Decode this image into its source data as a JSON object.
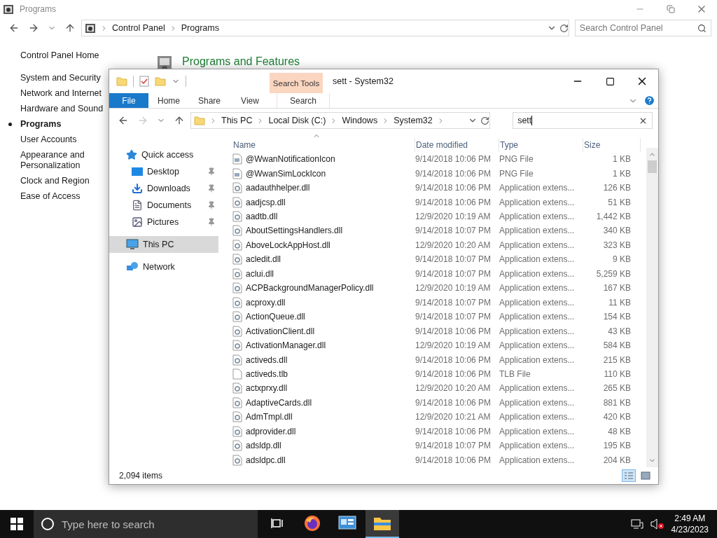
{
  "control_panel": {
    "title": "Programs",
    "breadcrumb": [
      "Control Panel",
      "Programs"
    ],
    "search_placeholder": "Search Control Panel",
    "nav": [
      {
        "label": "Control Panel Home",
        "kind": "home",
        "selected": false
      },
      {
        "label": "System and Security",
        "kind": "category",
        "selected": false
      },
      {
        "label": "Network and Internet",
        "kind": "category",
        "selected": false
      },
      {
        "label": "Hardware and Sound",
        "kind": "category",
        "selected": false
      },
      {
        "label": "Programs",
        "kind": "category",
        "selected": true
      },
      {
        "label": "User Accounts",
        "kind": "category",
        "selected": false
      },
      {
        "label": "Appearance and Personalization",
        "kind": "category",
        "selected": false
      },
      {
        "label": "Clock and Region",
        "kind": "category",
        "selected": false
      },
      {
        "label": "Ease of Access",
        "kind": "category",
        "selected": false
      }
    ],
    "heading": "Programs and Features"
  },
  "explorer": {
    "title": "sett - System32",
    "context_group": "Search Tools",
    "tabs": [
      {
        "label": "File",
        "kind": "file",
        "selected": false
      },
      {
        "label": "Home",
        "kind": "tab",
        "selected": false
      },
      {
        "label": "Share",
        "kind": "tab",
        "selected": false
      },
      {
        "label": "View",
        "kind": "tab",
        "selected": false
      },
      {
        "label": "Search",
        "kind": "context",
        "selected": false
      }
    ],
    "breadcrumb": [
      "This PC",
      "Local Disk (C:)",
      "Windows",
      "System32"
    ],
    "search_value": "sett",
    "nav": [
      {
        "label": "Quick access",
        "kind": "star",
        "selected": false,
        "children": [
          {
            "label": "Desktop",
            "kind": "desktop",
            "pinned": true,
            "selected": false
          },
          {
            "label": "Downloads",
            "kind": "downloads",
            "pinned": true,
            "selected": false
          },
          {
            "label": "Documents",
            "kind": "documents",
            "pinned": true,
            "selected": false
          },
          {
            "label": "Pictures",
            "kind": "pictures",
            "pinned": true,
            "selected": false
          }
        ]
      },
      {
        "label": "This PC",
        "kind": "pc",
        "selected": true
      },
      {
        "label": "Network",
        "kind": "network",
        "selected": false
      }
    ],
    "columns": [
      "Name",
      "Date modified",
      "Type",
      "Size"
    ],
    "rows": [
      {
        "name": "@WwanNotificationIcon",
        "kind": "png",
        "date": "9/14/2018 10:06 PM",
        "type": "PNG File",
        "size": "1 KB"
      },
      {
        "name": "@WwanSimLockIcon",
        "kind": "png",
        "date": "9/14/2018 10:06 PM",
        "type": "PNG File",
        "size": "1 KB"
      },
      {
        "name": "aadauthhelper.dll",
        "kind": "dll",
        "date": "9/14/2018 10:06 PM",
        "type": "Application extens...",
        "size": "126 KB"
      },
      {
        "name": "aadjcsp.dll",
        "kind": "dll",
        "date": "9/14/2018 10:06 PM",
        "type": "Application extens...",
        "size": "51 KB"
      },
      {
        "name": "aadtb.dll",
        "kind": "dll",
        "date": "12/9/2020 10:19 AM",
        "type": "Application extens...",
        "size": "1,442 KB"
      },
      {
        "name": "AboutSettingsHandlers.dll",
        "kind": "dll",
        "date": "9/14/2018 10:07 PM",
        "type": "Application extens...",
        "size": "340 KB"
      },
      {
        "name": "AboveLockAppHost.dll",
        "kind": "dll",
        "date": "12/9/2020 10:20 AM",
        "type": "Application extens...",
        "size": "323 KB"
      },
      {
        "name": "acledit.dll",
        "kind": "dll",
        "date": "9/14/2018 10:07 PM",
        "type": "Application extens...",
        "size": "9 KB"
      },
      {
        "name": "aclui.dll",
        "kind": "dll",
        "date": "9/14/2018 10:07 PM",
        "type": "Application extens...",
        "size": "5,259 KB"
      },
      {
        "name": "ACPBackgroundManagerPolicy.dll",
        "kind": "dll",
        "date": "12/9/2020 10:19 AM",
        "type": "Application extens...",
        "size": "167 KB"
      },
      {
        "name": "acproxy.dll",
        "kind": "dll",
        "date": "9/14/2018 10:07 PM",
        "type": "Application extens...",
        "size": "11 KB"
      },
      {
        "name": "ActionQueue.dll",
        "kind": "dll",
        "date": "9/14/2018 10:07 PM",
        "type": "Application extens...",
        "size": "154 KB"
      },
      {
        "name": "ActivationClient.dll",
        "kind": "dll",
        "date": "9/14/2018 10:06 PM",
        "type": "Application extens...",
        "size": "43 KB"
      },
      {
        "name": "ActivationManager.dll",
        "kind": "dll",
        "date": "12/9/2020 10:19 AM",
        "type": "Application extens...",
        "size": "584 KB"
      },
      {
        "name": "activeds.dll",
        "kind": "dll",
        "date": "9/14/2018 10:06 PM",
        "type": "Application extens...",
        "size": "215 KB"
      },
      {
        "name": "activeds.tlb",
        "kind": "tlb",
        "date": "9/14/2018 10:06 PM",
        "type": "TLB File",
        "size": "110 KB"
      },
      {
        "name": "actxprxy.dll",
        "kind": "dll",
        "date": "12/9/2020 10:20 AM",
        "type": "Application extens...",
        "size": "265 KB"
      },
      {
        "name": "AdaptiveCards.dll",
        "kind": "dll",
        "date": "9/14/2018 10:06 PM",
        "type": "Application extens...",
        "size": "881 KB"
      },
      {
        "name": "AdmTmpl.dll",
        "kind": "dll",
        "date": "12/9/2020 10:21 AM",
        "type": "Application extens...",
        "size": "420 KB"
      },
      {
        "name": "adprovider.dll",
        "kind": "dll",
        "date": "9/14/2018 10:06 PM",
        "type": "Application extens...",
        "size": "48 KB"
      },
      {
        "name": "adsldp.dll",
        "kind": "dll",
        "date": "9/14/2018 10:07 PM",
        "type": "Application extens...",
        "size": "195 KB"
      },
      {
        "name": "adsldpc.dll",
        "kind": "dll",
        "date": "9/14/2018 10:06 PM",
        "type": "Application extens...",
        "size": "204 KB"
      }
    ],
    "status": "2,094 items"
  },
  "taskbar": {
    "search_placeholder": "Type here to search",
    "apps": [
      {
        "kind": "taskview",
        "active": false
      },
      {
        "kind": "firefox",
        "active": false
      },
      {
        "kind": "controlpanel",
        "active": false
      },
      {
        "kind": "explorer",
        "active": true
      }
    ],
    "time": "2:49 AM",
    "date": "4/23/2023"
  }
}
